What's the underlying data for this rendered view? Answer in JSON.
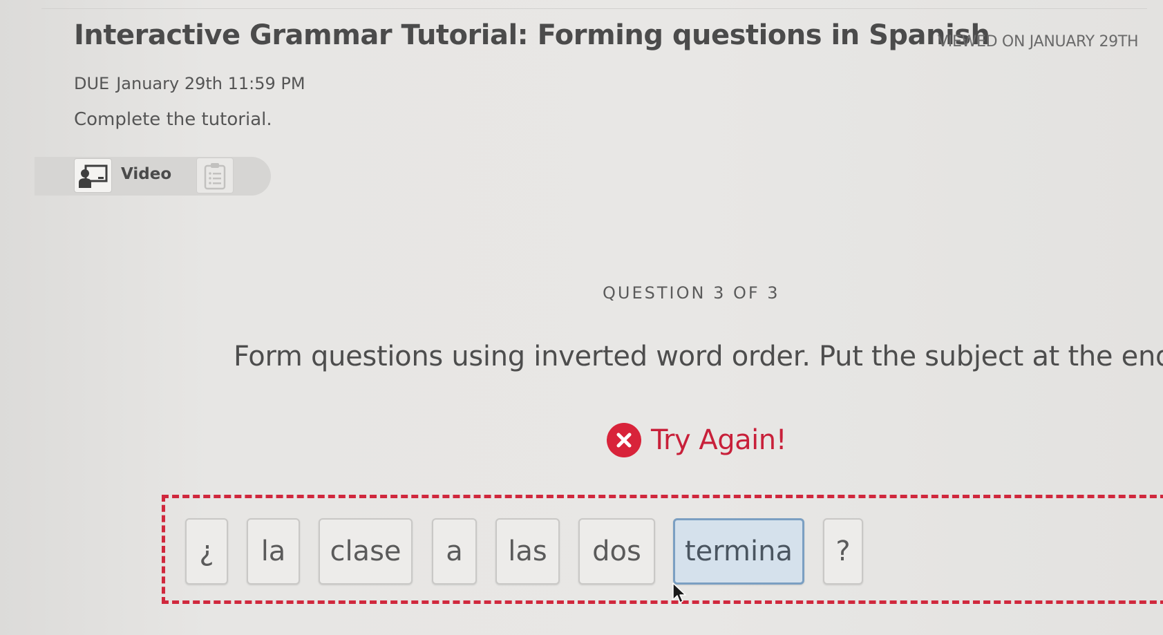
{
  "header": {
    "title": "Interactive Grammar Tutorial: Forming questions in Spanish",
    "viewed": "VIEWED ON JANUARY 29TH"
  },
  "due": {
    "label": "DUE",
    "date": "January 29th 11:59 PM"
  },
  "instructions": "Complete the tutorial.",
  "tabs": {
    "video_label": "Video",
    "video_icon": "presentation-icon",
    "list_icon": "clipboard-list-icon"
  },
  "question": {
    "counter": "QUESTION 3 OF 3",
    "prompt": "Form questions using inverted word order. Put the subject at the end.",
    "feedback": "Try Again!",
    "feedback_icon": "error-x-icon",
    "feedback_color": "#d8233a"
  },
  "tiles": [
    "¿",
    "la",
    "clase",
    "a",
    "las",
    "dos",
    "termina",
    "?"
  ],
  "selected_tile": "termina"
}
